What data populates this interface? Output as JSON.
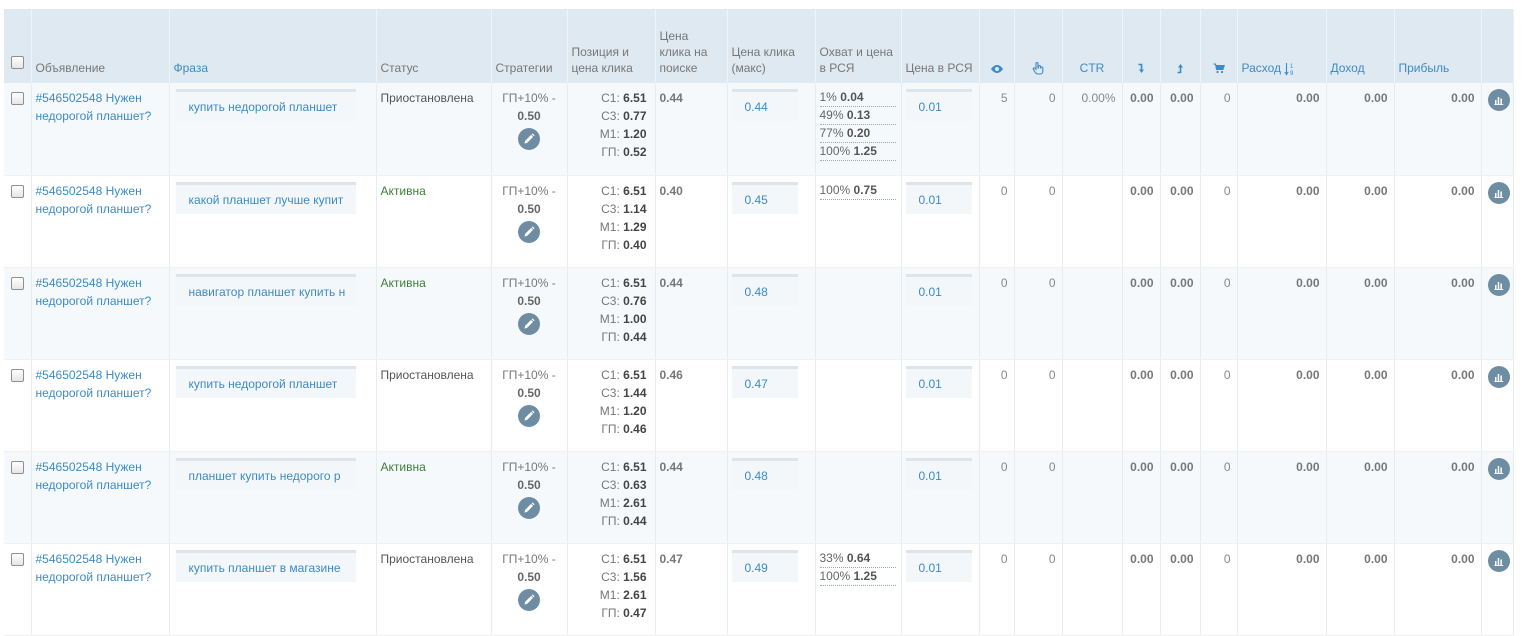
{
  "headers": {
    "ad": "Объявление",
    "phrase": "Фраза",
    "status": "Статус",
    "strategy": "Стратегии",
    "position": "Позиция и цена клика",
    "search_price": "Цена клика на поиске",
    "max_price": "Цена клика (макс)",
    "coverage": "Охват и цена в РСЯ",
    "rsya_price": "Цена в РСЯ",
    "views_icon": "eye-icon",
    "clicks_icon": "pointer-hand-icon",
    "ctr": "CTR",
    "in_icon": "arrow-down-icon",
    "out_icon": "arrow-up-icon",
    "cart_icon": "cart-icon",
    "expense": "Расход",
    "sort_icon": "sort-numeric-icon",
    "income": "Доход",
    "profit": "Прибыль"
  },
  "colors": {
    "link": "#3b8bc6",
    "header_bg": "#dfe9f1",
    "active_status": "#3e7f3a",
    "button_bg": "#6f8da2"
  },
  "rows": [
    {
      "ad": "#546502548 Нужен недорогой планшет?",
      "phrase": "купить недорогой планшет",
      "status": "Приостановлена",
      "status_type": "paused",
      "strategy": "ГП+10% -",
      "strategy_value": "0.50",
      "pos": [
        {
          "k": "С1:",
          "v": "6.51"
        },
        {
          "k": "С3:",
          "v": "0.77"
        },
        {
          "k": "М1:",
          "v": "1.20"
        },
        {
          "k": "ГП:",
          "v": "0.52"
        }
      ],
      "search_price": "0.44",
      "max_price": "0.44",
      "coverage": [
        {
          "p": "1%",
          "v": "0.04"
        },
        {
          "p": "49%",
          "v": "0.13"
        },
        {
          "p": "77%",
          "v": "0.20"
        },
        {
          "p": "100%",
          "v": "1.25"
        }
      ],
      "rsya_price": "0.01",
      "views": "5",
      "clicks": "0",
      "ctr": "0.00%",
      "in": "0.00",
      "out": "0.00",
      "cart": "0",
      "expense": "0.00",
      "income": "0.00",
      "profit": "0.00"
    },
    {
      "ad": "#546502548 Нужен недорогой планшет?",
      "phrase": "какой планшет лучше купит",
      "status": "Активна",
      "status_type": "active",
      "strategy": "ГП+10% -",
      "strategy_value": "0.50",
      "pos": [
        {
          "k": "С1:",
          "v": "6.51"
        },
        {
          "k": "С3:",
          "v": "1.14"
        },
        {
          "k": "М1:",
          "v": "1.29"
        },
        {
          "k": "ГП:",
          "v": "0.40"
        }
      ],
      "search_price": "0.40",
      "max_price": "0.45",
      "coverage": [
        {
          "p": "100%",
          "v": "0.75"
        }
      ],
      "rsya_price": "0.01",
      "views": "0",
      "clicks": "0",
      "ctr": "",
      "in": "0.00",
      "out": "0.00",
      "cart": "0",
      "expense": "0.00",
      "income": "0.00",
      "profit": "0.00"
    },
    {
      "ad": "#546502548 Нужен недорогой планшет?",
      "phrase": "навигатор планшет купить н",
      "status": "Активна",
      "status_type": "active",
      "strategy": "ГП+10% -",
      "strategy_value": "0.50",
      "pos": [
        {
          "k": "С1:",
          "v": "6.51"
        },
        {
          "k": "С3:",
          "v": "0.76"
        },
        {
          "k": "М1:",
          "v": "1.00"
        },
        {
          "k": "ГП:",
          "v": "0.44"
        }
      ],
      "search_price": "0.44",
      "max_price": "0.48",
      "coverage": [],
      "rsya_price": "0.01",
      "views": "0",
      "clicks": "0",
      "ctr": "",
      "in": "0.00",
      "out": "0.00",
      "cart": "0",
      "expense": "0.00",
      "income": "0.00",
      "profit": "0.00"
    },
    {
      "ad": "#546502548 Нужен недорогой планшет?",
      "phrase": "купить недорогой планшет",
      "status": "Приостановлена",
      "status_type": "paused",
      "strategy": "ГП+10% -",
      "strategy_value": "0.50",
      "pos": [
        {
          "k": "С1:",
          "v": "6.51"
        },
        {
          "k": "С3:",
          "v": "1.44"
        },
        {
          "k": "М1:",
          "v": "1.20"
        },
        {
          "k": "ГП:",
          "v": "0.46"
        }
      ],
      "search_price": "0.46",
      "max_price": "0.47",
      "coverage": [],
      "rsya_price": "0.01",
      "views": "0",
      "clicks": "0",
      "ctr": "",
      "in": "0.00",
      "out": "0.00",
      "cart": "0",
      "expense": "0.00",
      "income": "0.00",
      "profit": "0.00"
    },
    {
      "ad": "#546502548 Нужен недорогой планшет?",
      "phrase": "планшет купить недорого р",
      "status": "Активна",
      "status_type": "active",
      "strategy": "ГП+10% -",
      "strategy_value": "0.50",
      "pos": [
        {
          "k": "С1:",
          "v": "6.51"
        },
        {
          "k": "С3:",
          "v": "0.63"
        },
        {
          "k": "М1:",
          "v": "2.61"
        },
        {
          "k": "ГП:",
          "v": "0.44"
        }
      ],
      "search_price": "0.44",
      "max_price": "0.48",
      "coverage": [],
      "rsya_price": "0.01",
      "views": "0",
      "clicks": "0",
      "ctr": "",
      "in": "0.00",
      "out": "0.00",
      "cart": "0",
      "expense": "0.00",
      "income": "0.00",
      "profit": "0.00"
    },
    {
      "ad": "#546502548 Нужен недорогой планшет?",
      "phrase": "купить планшет в магазине",
      "status": "Приостановлена",
      "status_type": "paused",
      "strategy": "ГП+10% -",
      "strategy_value": "0.50",
      "pos": [
        {
          "k": "С1:",
          "v": "6.51"
        },
        {
          "k": "С3:",
          "v": "1.56"
        },
        {
          "k": "М1:",
          "v": "2.61"
        },
        {
          "k": "ГП:",
          "v": "0.47"
        }
      ],
      "search_price": "0.47",
      "max_price": "0.49",
      "coverage": [
        {
          "p": "33%",
          "v": "0.64"
        },
        {
          "p": "100%",
          "v": "1.25"
        }
      ],
      "rsya_price": "0.01",
      "views": "0",
      "clicks": "0",
      "ctr": "",
      "in": "0.00",
      "out": "0.00",
      "cart": "0",
      "expense": "0.00",
      "income": "0.00",
      "profit": "0.00"
    }
  ]
}
